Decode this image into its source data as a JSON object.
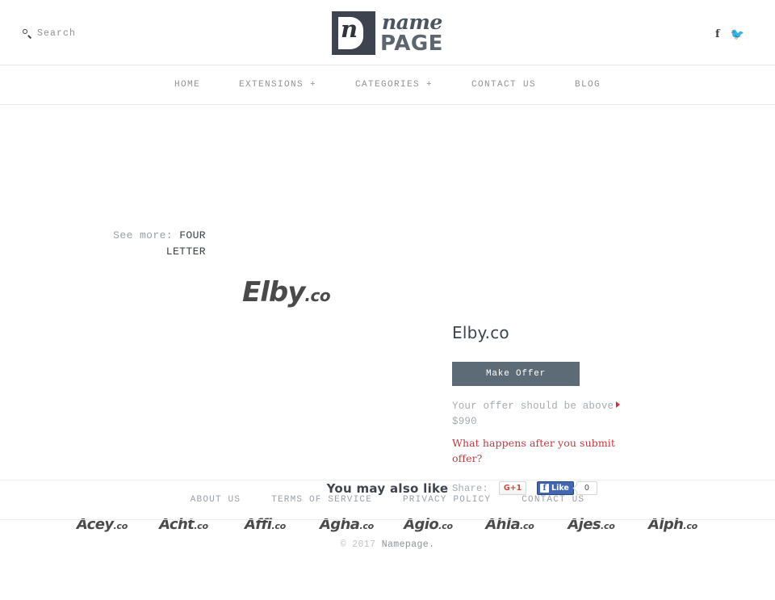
{
  "header": {
    "search": {
      "label": "Search",
      "icon": "search-icon"
    },
    "logo": {
      "mark_letter": "n",
      "name_word": "name",
      "page_word": "PAGE"
    },
    "social": [
      {
        "name": "facebook-icon",
        "glyph": "f"
      },
      {
        "name": "twitter-icon",
        "glyph": "🐦"
      }
    ]
  },
  "nav": {
    "items": [
      {
        "label": "HOME"
      },
      {
        "label": "EXTENSIONS +"
      },
      {
        "label": "CATEGORIES +"
      },
      {
        "label": "CONTACT US"
      },
      {
        "label": "BLOG"
      }
    ]
  },
  "content": {
    "see_more_prefix": "See more:",
    "see_more_category": "FOUR LETTER",
    "domain_art": {
      "name": "Elby",
      "tld": ".co"
    },
    "detail": {
      "title": "Elby.co",
      "make_offer_label": "Make Offer",
      "offer_note": "Your offer should be above $990",
      "offer_link": "What happens after you submit offer?",
      "share_label": "Share:",
      "gplus_label": "G+1",
      "fb_like_label": "Like",
      "fb_like_glyph": "f",
      "fb_count": "0"
    }
  },
  "also_like": {
    "title": "You may also like",
    "items": [
      {
        "name": "Acey",
        "tld": ".co"
      },
      {
        "name": "Acht",
        "tld": ".co"
      },
      {
        "name": "Affi",
        "tld": ".co"
      },
      {
        "name": "Agha",
        "tld": ".co"
      },
      {
        "name": "Agio",
        "tld": ".co"
      },
      {
        "name": "Ahla",
        "tld": ".co"
      },
      {
        "name": "Ajes",
        "tld": ".co"
      },
      {
        "name": "Alph",
        "tld": ".co"
      }
    ]
  },
  "footer": {
    "links": [
      {
        "label": "ABOUT US"
      },
      {
        "label": "TERMS OF SERVICE"
      },
      {
        "label": "PRIVACY POLICY"
      },
      {
        "label": "CONTACT US"
      }
    ],
    "copyright_year": "© 2017",
    "copyright_brand": "Namepage."
  },
  "colors": {
    "accent_button": "#5d6b76",
    "link_red": "#c0393f",
    "logo_dark": "#3d4450",
    "text_muted": "#9aa0a6"
  }
}
